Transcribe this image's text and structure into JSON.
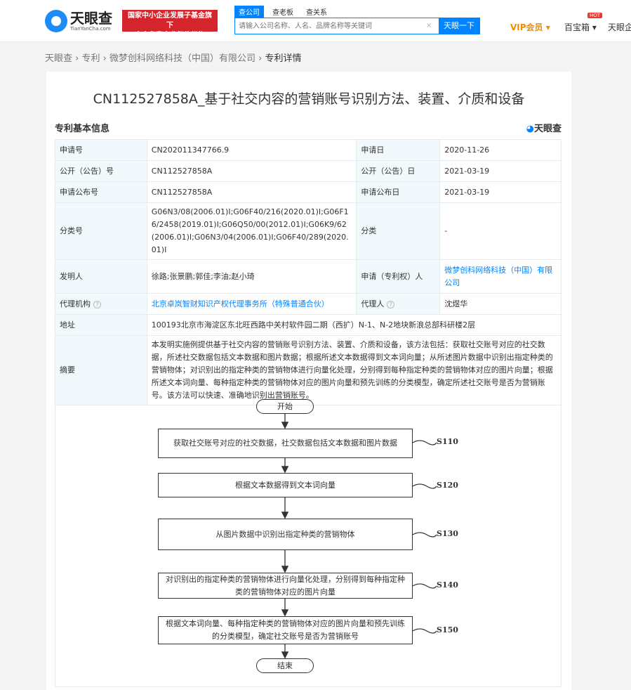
{
  "header": {
    "logo": "天眼查",
    "logo_sub": "TianYanCha.com",
    "badge_line1": "国家中小企业发展子基金旗下",
    "badge_line2": "官方备案企业征信机构",
    "search_tabs": [
      "查公司",
      "查老板",
      "查关系"
    ],
    "search_placeholder": "请输入公司名称、人名、品牌名称等关键词",
    "clear": "×",
    "search_button": "天眼一下",
    "vip": "VIP会员 ▾",
    "treasure": "百宝箱 ▾",
    "hot": "HOT",
    "more": "天眼企"
  },
  "breadcrumb": [
    "天眼查",
    "专利",
    "微梦创科网络科技（中国）有限公司",
    "专利详情"
  ],
  "breadcrumb_sep": "›",
  "patent": {
    "title": "CN112527858A_基于社交内容的营销账号识别方法、装置、介质和设备",
    "section": "专利基本信息",
    "brand": "天眼查",
    "rows": {
      "app_no_label": "申请号",
      "app_no": "CN202011347766.9",
      "app_date_label": "申请日",
      "app_date": "2020-11-26",
      "pub_no_label": "公开（公告）号",
      "pub_no": "CN112527858A",
      "pub_date_label": "公开（公告）日",
      "pub_date": "2021-03-19",
      "app_pub_no_label": "申请公布号",
      "app_pub_no": "CN112527858A",
      "app_pub_date_label": "申请公布日",
      "app_pub_date": "2021-03-19",
      "class_no_label": "分类号",
      "class_no": "G06N3/08(2006.01)I;G06F40/216(2020.01)I;G06F16/2458(2019.01)I;G06Q50/00(2012.01)I;G06K9/62(2006.01)I;G06N3/04(2006.01)I;G06F40/289(2020.01)I",
      "class_label": "分类",
      "class": "-",
      "inventor_label": "发明人",
      "inventor": "徐路;张景鹏;郭佳;李油;赵小琦",
      "applicant_label": "申请（专利权）人",
      "applicant": "微梦创科网络科技（中国）有限公司",
      "agency_label": "代理机构",
      "agency": "北京卓岚智财知识产权代理事务所（特殊普通合伙）",
      "agent_label": "代理人",
      "agent": "沈煜华",
      "address_label": "地址",
      "address": "100193北京市海淀区东北旺西路中关村软件园二期（西扩）N-1、N-2地块新浪总部科研楼2层",
      "abstract_label": "摘要",
      "abstract": "本发明实施例提供基于社交内容的营销账号识别方法、装置、介质和设备，该方法包括：获取社交账号对应的社交数据，所述社交数据包括文本数据和图片数据；根据所述文本数据得到文本词向量；从所述图片数据中识别出指定种类的营销物体；对识别出的指定种类的营销物体进行向量化处理，分别得到每种指定种类的营销物体对应的图片向量；根据所述文本词向量、每种指定种类的营销物体对应的图片向量和预先训练的分类模型，确定所述社交账号是否为营销账号。该方法可以快速、准确地识别出营销账号。"
    }
  },
  "flowchart": {
    "start": "开始",
    "end": "结束",
    "steps": [
      {
        "text": "获取社交账号对应的社交数据，社交数据包括文本数据和图片数据",
        "label": "S110"
      },
      {
        "text": "根据文本数据得到文本词向量",
        "label": "S120"
      },
      {
        "text": "从图片数据中识别出指定种类的营销物体",
        "label": "S130"
      },
      {
        "text": "对识别出的指定种类的营销物体进行向量化处理，分别得到每种指定种类的营销物体对应的图片向量",
        "label": "S140"
      },
      {
        "text": "根据文本词向量、每种指定种类的营销物体对应的图片向量和预先训练的分类模型，确定社交账号是否为营销账号",
        "label": "S150"
      }
    ]
  }
}
